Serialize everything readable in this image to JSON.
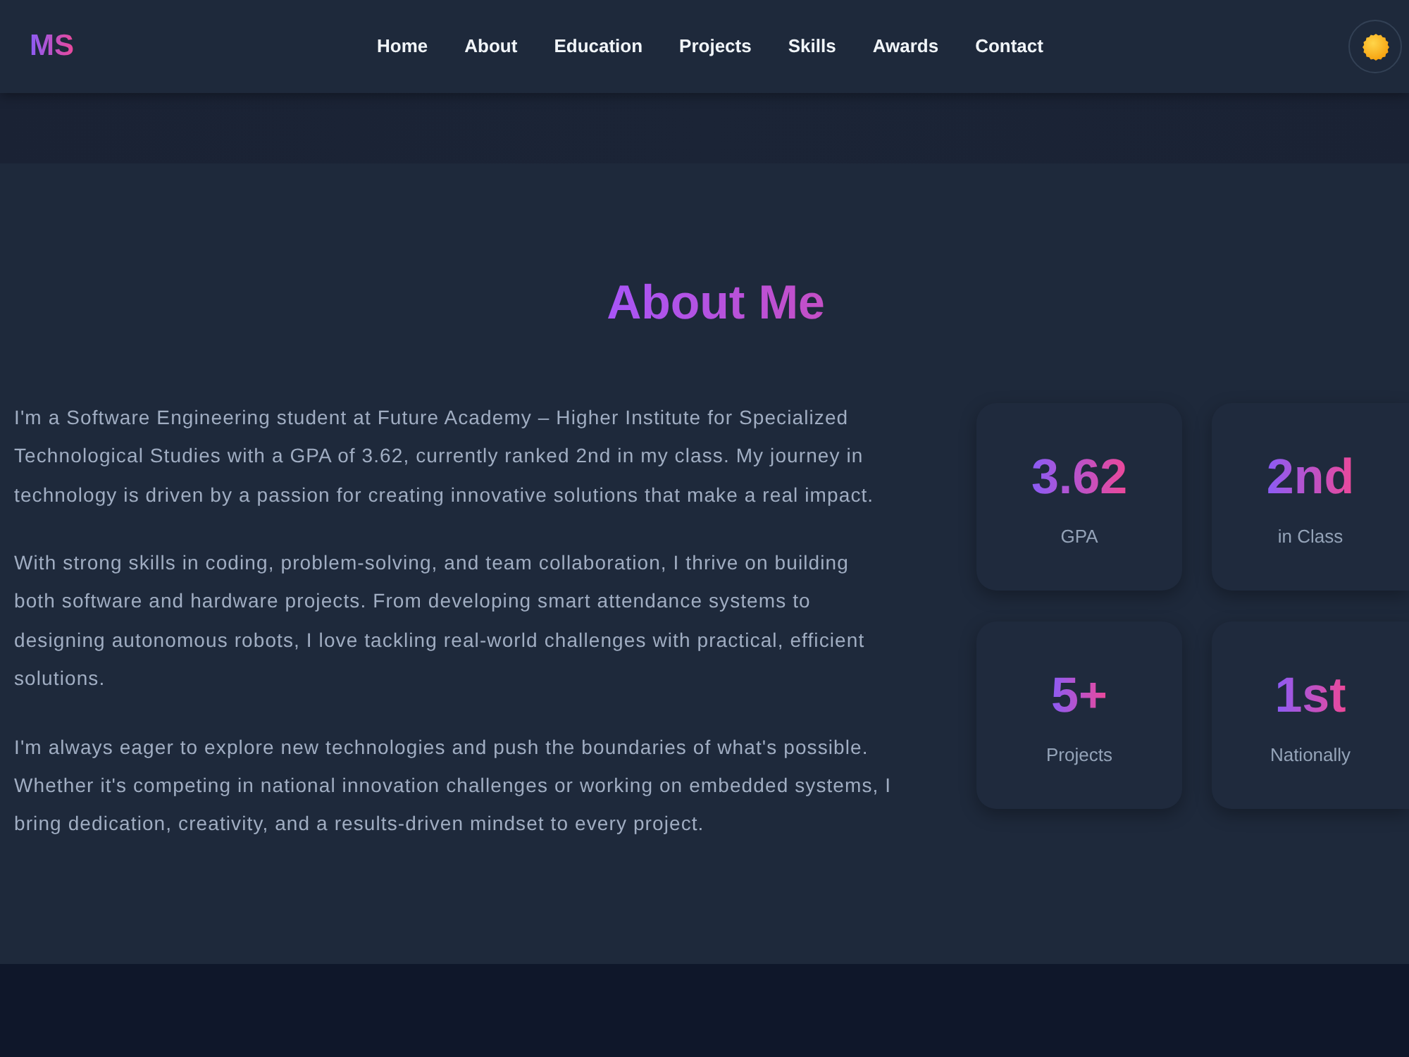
{
  "navbar": {
    "logo": "MS",
    "links": [
      {
        "label": "Home"
      },
      {
        "label": "About"
      },
      {
        "label": "Education"
      },
      {
        "label": "Projects"
      },
      {
        "label": "Skills"
      },
      {
        "label": "Awards"
      },
      {
        "label": "Contact"
      }
    ]
  },
  "about": {
    "title": "About Me",
    "paragraphs": [
      "I'm a Software Engineering student at Future Academy – Higher Institute for Specialized Technological Studies with a GPA of 3.62, currently ranked 2nd in my class. My journey in technology is driven by a passion for creating innovative solutions that make a real impact.",
      "With strong skills in coding, problem-solving, and team collaboration, I thrive on building both software and hardware projects. From developing smart attendance systems to designing autonomous robots, I love tackling real-world challenges with practical, efficient solutions.",
      "I'm always eager to explore new technologies and push the boundaries of what's possible. Whether it's competing in national innovation challenges or working on embedded systems, I bring dedication, creativity, and a results-driven mindset to every project."
    ],
    "stats": [
      {
        "value": "3.62",
        "label": "GPA"
      },
      {
        "value": "2nd",
        "label": "in Class"
      },
      {
        "value": "5+",
        "label": "Projects"
      },
      {
        "value": "1st",
        "label": "Nationally"
      }
    ]
  }
}
